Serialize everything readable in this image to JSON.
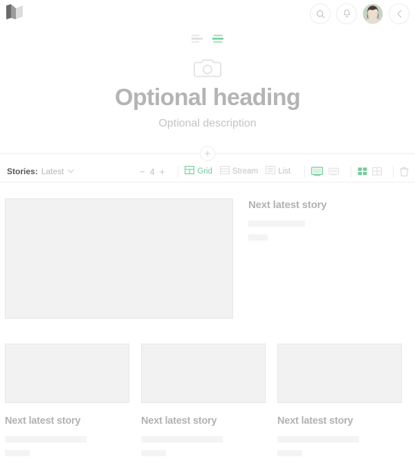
{
  "brand": {
    "logo_name": "medium-logo"
  },
  "topbar": {
    "search_icon": "search-icon",
    "notifications_icon": "bell-icon",
    "avatar_label": "avatar",
    "collapse_icon": "chevron-left-icon"
  },
  "header": {
    "align_left_icon": "align-left-icon",
    "align_center_icon": "align-center-icon",
    "cover_icon": "camera-icon",
    "heading": "Optional heading",
    "description": "Optional description",
    "add_label": "+"
  },
  "toolbar": {
    "stories_label": "Stories:",
    "sort_value": "Latest",
    "chevron": "▾",
    "stepper": {
      "minus": "−",
      "value": "4",
      "plus": "+"
    },
    "views": [
      {
        "label": "Grid",
        "icon": "grid-view-icon",
        "active": true
      },
      {
        "label": "Stream",
        "icon": "stream-view-icon",
        "active": false
      },
      {
        "label": "List",
        "icon": "list-view-icon",
        "active": false
      }
    ],
    "size_icons": [
      {
        "icon": "desktop-large-icon",
        "active": true
      },
      {
        "icon": "desktop-small-icon",
        "active": false
      }
    ],
    "layout_icons": [
      {
        "icon": "grid-dense-icon",
        "active": true
      },
      {
        "icon": "grid-quad-icon",
        "active": false
      }
    ],
    "delete_icon": "trash-icon"
  },
  "colors": {
    "accent_green": "#6ecb96",
    "text_gray": "#b2b2b2",
    "placeholder_gray": "#f2f2f2",
    "border_gray": "#e6e6e6"
  },
  "content": {
    "hero": {
      "title": "Next latest story",
      "image": "story-image-placeholder"
    },
    "cards": [
      {
        "title": "Next latest story",
        "image": "story-image-placeholder"
      },
      {
        "title": "Next latest story",
        "image": "story-image-placeholder"
      },
      {
        "title": "Next latest story",
        "image": "story-image-placeholder"
      }
    ]
  }
}
